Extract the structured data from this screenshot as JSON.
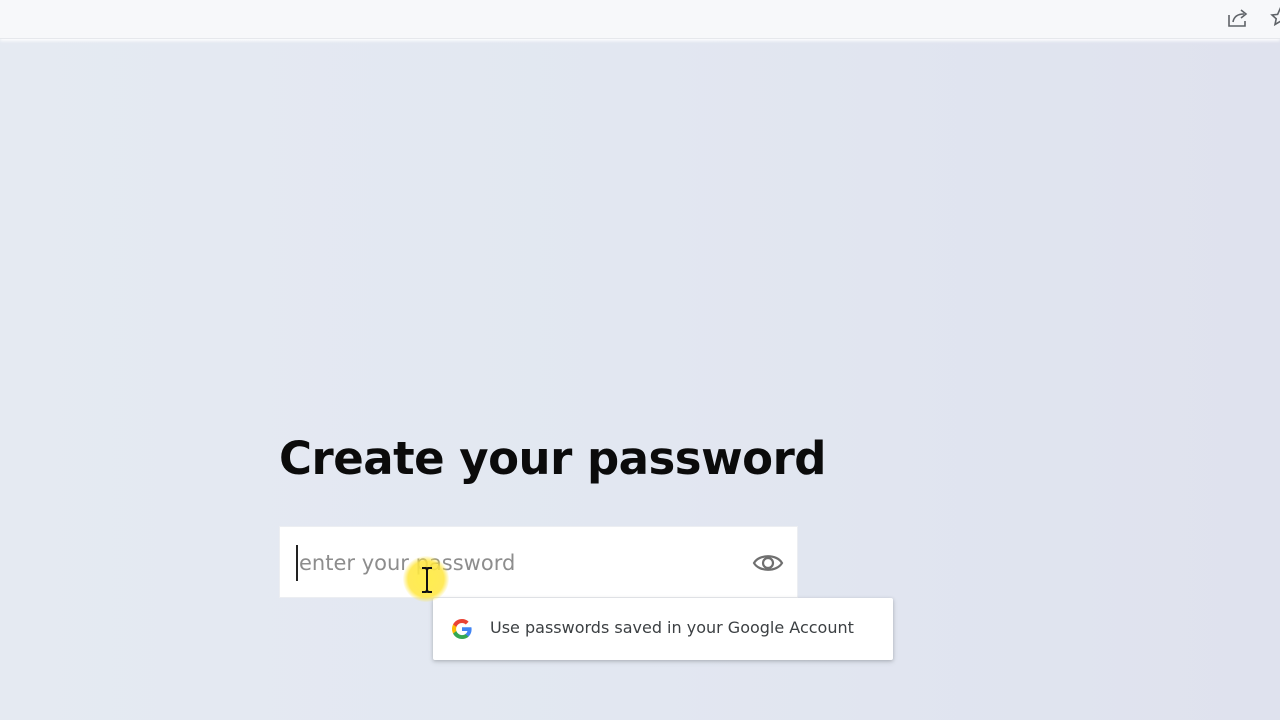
{
  "toolbar": {
    "icons": [
      "share-icon",
      "star-icon"
    ]
  },
  "page": {
    "heading": "Create your password"
  },
  "password_field": {
    "placeholder": "enter your password",
    "value": "",
    "toggle_icon": "eye-icon"
  },
  "autofill_suggestion": {
    "icon": "google-icon",
    "label": "Use passwords saved in your Google Account"
  },
  "colors": {
    "background": "#e2e7f1",
    "heading": "#0b0b0b",
    "placeholder": "#8d8d8d",
    "suggestion_text": "#3c4043"
  }
}
